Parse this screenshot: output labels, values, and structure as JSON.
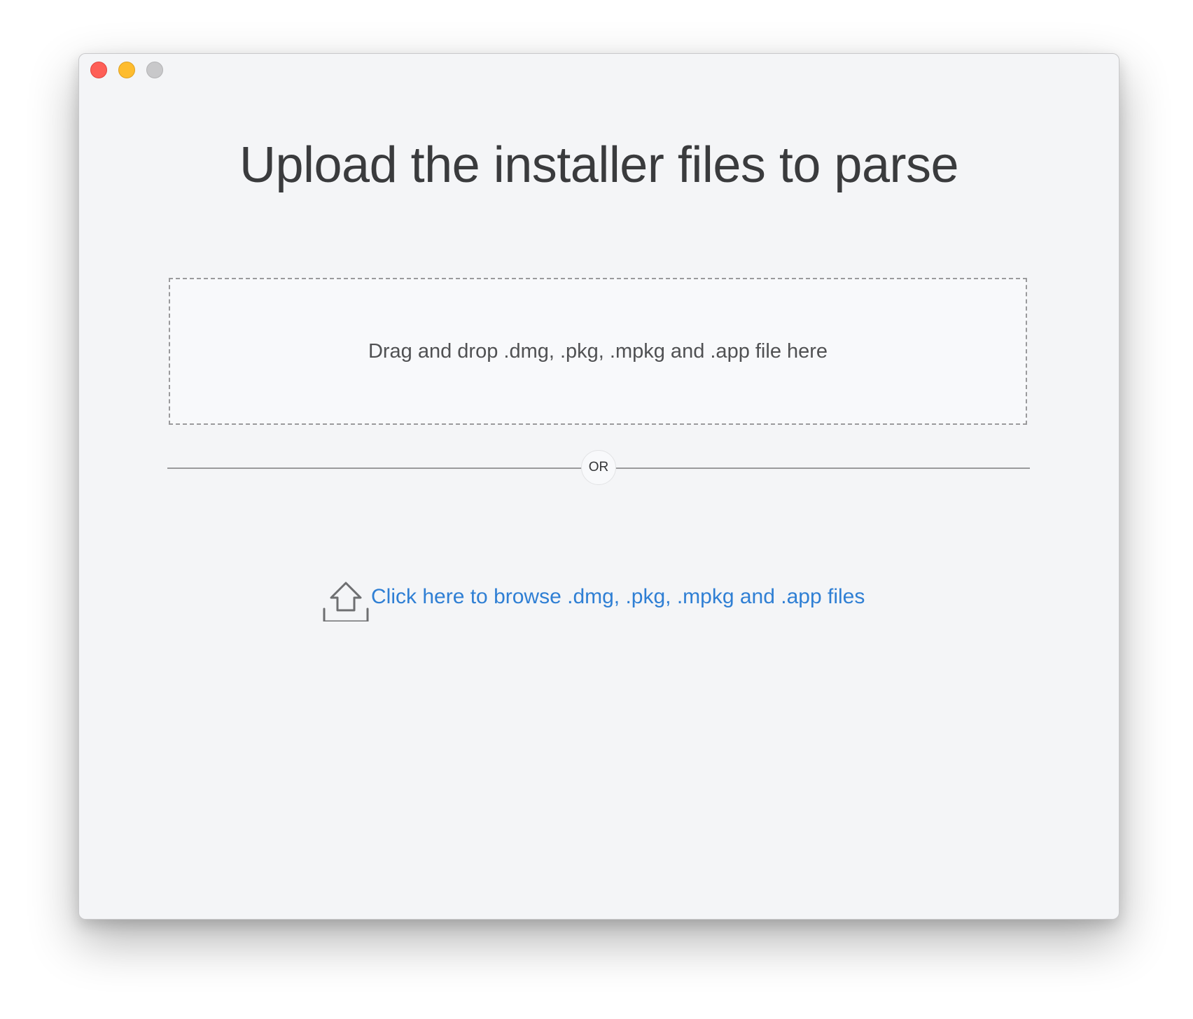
{
  "window": {
    "controls": {
      "close": "close-icon",
      "minimize": "minimize-icon",
      "maximize": "maximize-icon"
    }
  },
  "main": {
    "title": "Upload the installer files to parse",
    "dropzone": {
      "text": "Drag and drop .dmg, .pkg, .mpkg and .app file here"
    },
    "divider_label": "OR",
    "browse": {
      "icon": "upload-icon",
      "label": "Click here to browse .dmg, .pkg, .mpkg and .app files"
    }
  },
  "colors": {
    "window_bg": "#f4f5f7",
    "link": "#2f7fd4",
    "title_text": "#3a3b3d",
    "close": "#fe5f57",
    "minimize": "#febc2e",
    "maximize_disabled": "#c8c8ca"
  }
}
